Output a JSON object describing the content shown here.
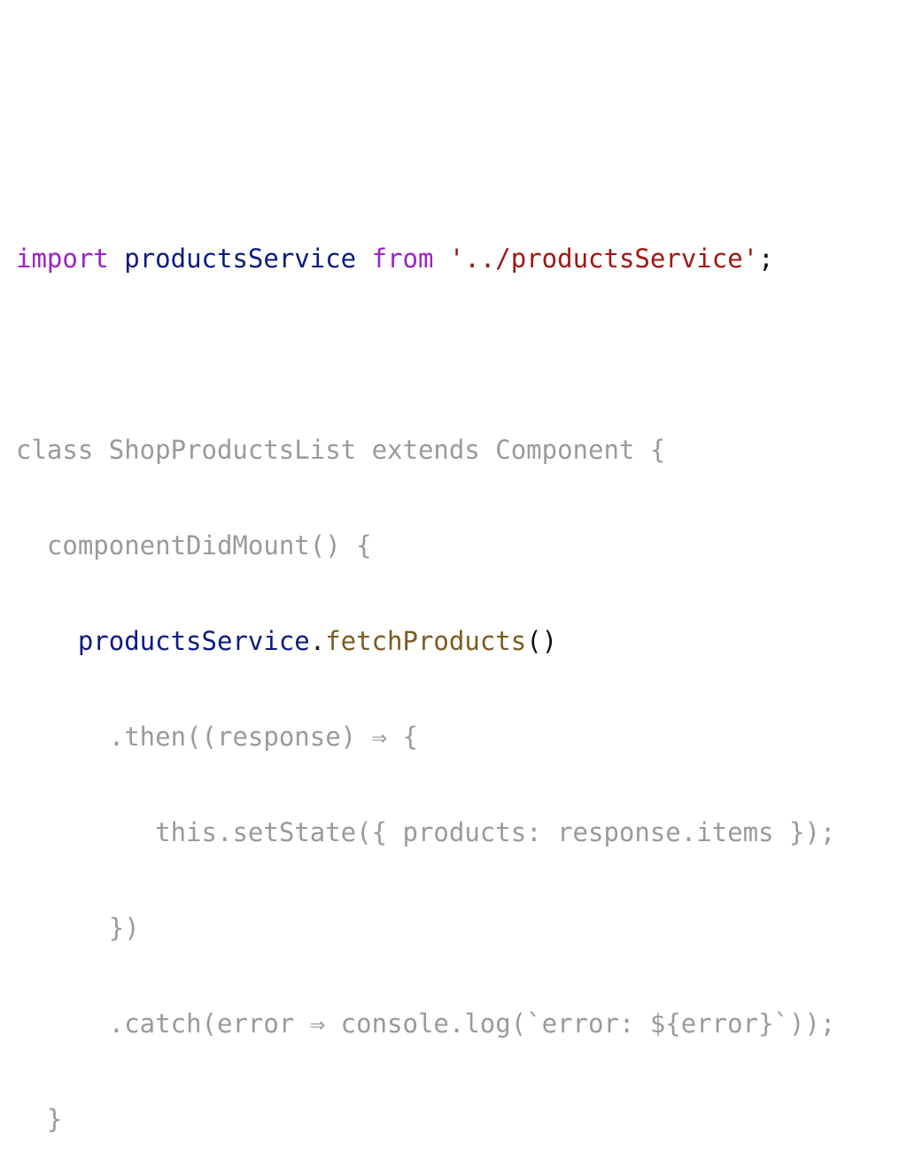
{
  "code": {
    "line1": {
      "kw_import": "import",
      "ident": "productsService",
      "kw_from": "from",
      "path": "'../productsService'",
      "semicolon": ";"
    },
    "line3": "class ShopProductsList extends Component {",
    "line4": "componentDidMount() {",
    "line5": {
      "object": "productsService",
      "dot": ".",
      "method": "fetchProducts",
      "parens": "()"
    },
    "line6": ".then((response) ⇒ {",
    "line7": "this.setState({ products: response.items });",
    "line8": "})",
    "line9": ".catch(error ⇒ console.log(`error: ${error}`));",
    "line10": "}"
  },
  "colors": {
    "keyword": "#a020c8",
    "identifier": "#0b1b7f",
    "string": "#a31515",
    "function": "#7a5c1e",
    "punctuation": "#111111",
    "dimmed": "#9a9a9a",
    "background": "#ffffff"
  }
}
